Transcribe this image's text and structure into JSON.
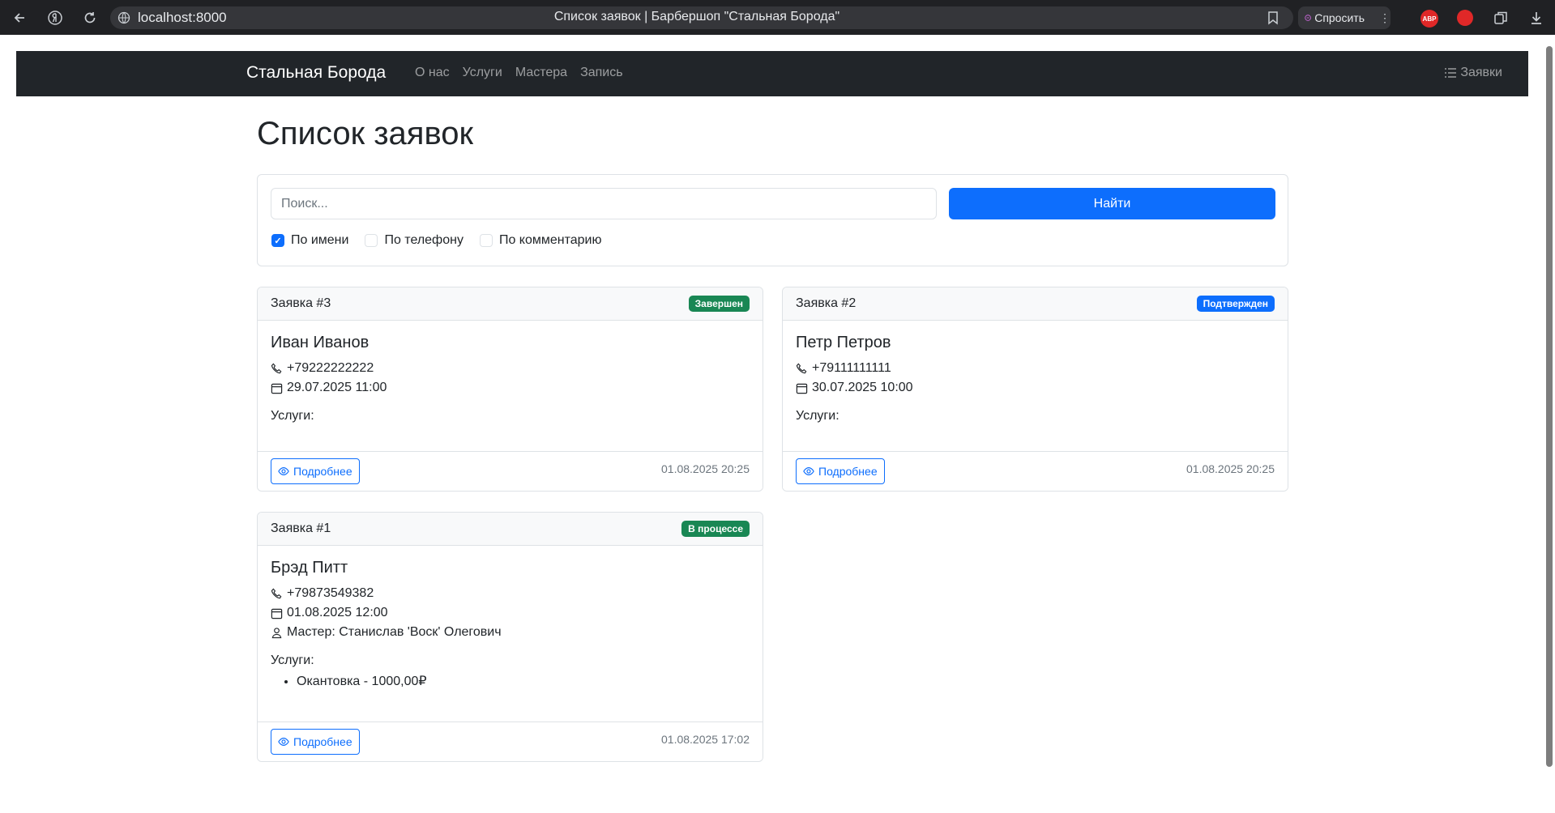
{
  "browser": {
    "url": "localhost:8000",
    "tab_title": "Список заявок | Барбершоп \"Стальная Борода\"",
    "ask_label": "Спросить",
    "abp_label": "ABP"
  },
  "navbar": {
    "brand": "Стальная Борода",
    "links": [
      "О нас",
      "Услуги",
      "Мастера",
      "Запись"
    ],
    "right_link": "Заявки"
  },
  "page": {
    "title": "Список заявок"
  },
  "search": {
    "placeholder": "Поиск...",
    "button_label": "Найти",
    "filters": [
      {
        "label": "По имени",
        "checked": true
      },
      {
        "label": "По телефону",
        "checked": false
      },
      {
        "label": "По комментарию",
        "checked": false
      }
    ]
  },
  "colors": {
    "primary": "#0d6efd",
    "success": "#198754",
    "navbar": "#212529"
  },
  "orders": [
    {
      "number": "Заявка #3",
      "status": "Завершен",
      "status_color": "#198754",
      "name": "Иван Иванов",
      "phone": "+79222222222",
      "datetime": "29.07.2025 11:00",
      "master": "",
      "services_label": "Услуги:",
      "services": [],
      "details_label": "Подробнее",
      "created": "01.08.2025 20:25"
    },
    {
      "number": "Заявка #2",
      "status": "Подтвержден",
      "status_color": "#0d6efd",
      "name": "Петр Петров",
      "phone": "+79111111111",
      "datetime": "30.07.2025 10:00",
      "master": "",
      "services_label": "Услуги:",
      "services": [],
      "details_label": "Подробнее",
      "created": "01.08.2025 20:25"
    },
    {
      "number": "Заявка #1",
      "status": "В процессе",
      "status_color": "#198754",
      "name": "Брэд Питт",
      "phone": "+79873549382",
      "datetime": "01.08.2025 12:00",
      "master": "Мастер: Станислав 'Воск' Олегович",
      "services_label": "Услуги:",
      "services": [
        "Окантовка - 1000,00₽"
      ],
      "details_label": "Подробнее",
      "created": "01.08.2025 17:02"
    }
  ]
}
